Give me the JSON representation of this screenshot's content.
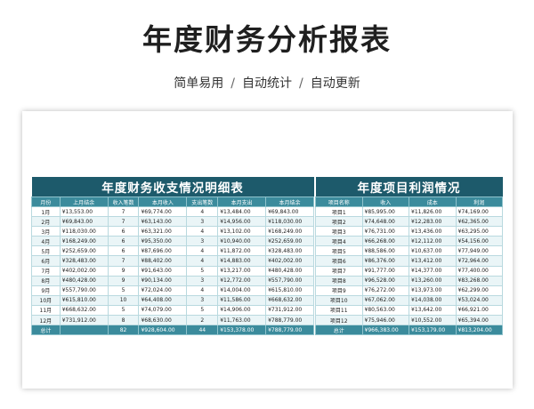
{
  "page": {
    "title": "年度财务分析报表",
    "subtitle_items": [
      "简单易用",
      "自动统计",
      "自动更新"
    ],
    "separator": "/"
  },
  "left_table": {
    "title": "年度财务收支情况明细表",
    "headers": [
      "月份",
      "上月结余",
      "收入笔数",
      "本月收入",
      "支出笔数",
      "本月支出",
      "本月结余"
    ],
    "rows": [
      [
        "1月",
        "¥13,553.00",
        "7",
        "¥69,774.00",
        "4",
        "¥13,484.00",
        "¥69,843.00"
      ],
      [
        "2月",
        "¥69,843.00",
        "7",
        "¥63,143.00",
        "3",
        "¥14,956.00",
        "¥118,030.00"
      ],
      [
        "3月",
        "¥118,030.00",
        "6",
        "¥63,321.00",
        "4",
        "¥13,102.00",
        "¥168,249.00"
      ],
      [
        "4月",
        "¥168,249.00",
        "6",
        "¥95,350.00",
        "3",
        "¥10,940.00",
        "¥252,659.00"
      ],
      [
        "5月",
        "¥252,659.00",
        "6",
        "¥87,696.00",
        "4",
        "¥11,872.00",
        "¥328,483.00"
      ],
      [
        "6月",
        "¥328,483.00",
        "7",
        "¥88,402.00",
        "4",
        "¥14,883.00",
        "¥402,002.00"
      ],
      [
        "7月",
        "¥402,002.00",
        "9",
        "¥91,643.00",
        "5",
        "¥13,217.00",
        "¥480,428.00"
      ],
      [
        "8月",
        "¥480,428.00",
        "9",
        "¥90,134.00",
        "3",
        "¥12,772.00",
        "¥557,790.00"
      ],
      [
        "9月",
        "¥557,790.00",
        "5",
        "¥72,024.00",
        "4",
        "¥14,004.00",
        "¥615,810.00"
      ],
      [
        "10月",
        "¥615,810.00",
        "10",
        "¥64,408.00",
        "3",
        "¥11,586.00",
        "¥668,632.00"
      ],
      [
        "11月",
        "¥668,632.00",
        "5",
        "¥74,079.00",
        "5",
        "¥14,906.00",
        "¥731,912.00"
      ],
      [
        "12月",
        "¥731,912.00",
        "8",
        "¥68,630.00",
        "2",
        "¥11,763.00",
        "¥788,779.00"
      ]
    ],
    "total": [
      "总计",
      "",
      "82",
      "¥928,604.00",
      "44",
      "¥153,378.00",
      "¥788,779.00"
    ]
  },
  "right_table": {
    "title": "年度项目利润情况",
    "headers": [
      "项目名称",
      "收入",
      "成本",
      "利润"
    ],
    "rows": [
      [
        "项目1",
        "¥85,995.00",
        "¥11,826.00",
        "¥74,169.00"
      ],
      [
        "项目2",
        "¥74,648.00",
        "¥12,283.00",
        "¥62,365.00"
      ],
      [
        "项目3",
        "¥76,731.00",
        "¥13,436.00",
        "¥63,295.00"
      ],
      [
        "项目4",
        "¥66,268.00",
        "¥12,112.00",
        "¥54,156.00"
      ],
      [
        "项目5",
        "¥88,586.00",
        "¥10,637.00",
        "¥77,949.00"
      ],
      [
        "项目6",
        "¥86,376.00",
        "¥13,412.00",
        "¥72,964.00"
      ],
      [
        "项目7",
        "¥91,777.00",
        "¥14,377.00",
        "¥77,400.00"
      ],
      [
        "项目8",
        "¥96,528.00",
        "¥13,260.00",
        "¥83,268.00"
      ],
      [
        "项目9",
        "¥76,272.00",
        "¥13,973.00",
        "¥62,299.00"
      ],
      [
        "项目10",
        "¥67,062.00",
        "¥14,038.00",
        "¥53,024.00"
      ],
      [
        "项目11",
        "¥80,563.00",
        "¥13,642.00",
        "¥66,921.00"
      ],
      [
        "项目12",
        "¥75,946.00",
        "¥10,552.00",
        "¥65,394.00"
      ]
    ],
    "total": [
      "总计",
      "¥966,383.00",
      "¥153,179.00",
      "¥813,204.00"
    ]
  }
}
